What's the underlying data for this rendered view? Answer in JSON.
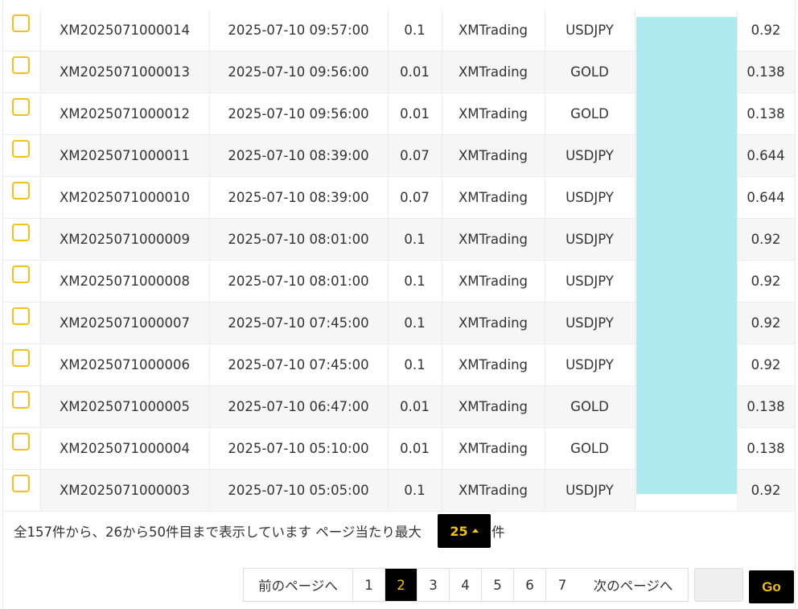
{
  "rows": [
    {
      "id": "XM2025071000014",
      "datetime": "2025-07-10 09:57:00",
      "lot": "0.1",
      "broker": "XMTrading",
      "symbol": "USDJPY",
      "value": "0.92"
    },
    {
      "id": "XM2025071000013",
      "datetime": "2025-07-10 09:56:00",
      "lot": "0.01",
      "broker": "XMTrading",
      "symbol": "GOLD",
      "value": "0.138"
    },
    {
      "id": "XM2025071000012",
      "datetime": "2025-07-10 09:56:00",
      "lot": "0.01",
      "broker": "XMTrading",
      "symbol": "GOLD",
      "value": "0.138"
    },
    {
      "id": "XM2025071000011",
      "datetime": "2025-07-10 08:39:00",
      "lot": "0.07",
      "broker": "XMTrading",
      "symbol": "USDJPY",
      "value": "0.644"
    },
    {
      "id": "XM2025071000010",
      "datetime": "2025-07-10 08:39:00",
      "lot": "0.07",
      "broker": "XMTrading",
      "symbol": "USDJPY",
      "value": "0.644"
    },
    {
      "id": "XM2025071000009",
      "datetime": "2025-07-10 08:01:00",
      "lot": "0.1",
      "broker": "XMTrading",
      "symbol": "USDJPY",
      "value": "0.92"
    },
    {
      "id": "XM2025071000008",
      "datetime": "2025-07-10 08:01:00",
      "lot": "0.1",
      "broker": "XMTrading",
      "symbol": "USDJPY",
      "value": "0.92"
    },
    {
      "id": "XM2025071000007",
      "datetime": "2025-07-10 07:45:00",
      "lot": "0.1",
      "broker": "XMTrading",
      "symbol": "USDJPY",
      "value": "0.92"
    },
    {
      "id": "XM2025071000006",
      "datetime": "2025-07-10 07:45:00",
      "lot": "0.1",
      "broker": "XMTrading",
      "symbol": "USDJPY",
      "value": "0.92"
    },
    {
      "id": "XM2025071000005",
      "datetime": "2025-07-10 06:47:00",
      "lot": "0.01",
      "broker": "XMTrading",
      "symbol": "GOLD",
      "value": "0.138"
    },
    {
      "id": "XM2025071000004",
      "datetime": "2025-07-10 05:10:00",
      "lot": "0.01",
      "broker": "XMTrading",
      "symbol": "GOLD",
      "value": "0.138"
    },
    {
      "id": "XM2025071000003",
      "datetime": "2025-07-10 05:05:00",
      "lot": "0.1",
      "broker": "XMTrading",
      "symbol": "USDJPY",
      "value": "0.92"
    }
  ],
  "summary": {
    "text": "全157件から、26から50件目まで表示しています ページ当たり最大",
    "per_page": "25",
    "unit": "件"
  },
  "pagination": {
    "prev_label": "前のページへ",
    "next_label": "次のページへ",
    "pages": [
      "1",
      "2",
      "3",
      "4",
      "5",
      "6",
      "7"
    ],
    "active_page": "2"
  },
  "jump": {
    "value": "",
    "go_label": "Go"
  },
  "colors": {
    "accent": "#f2c21b",
    "mask": "#aeeaee",
    "dark": "#000000"
  },
  "icons": {
    "checkbox": "checkbox-icon",
    "caret": "caret-up-icon"
  }
}
